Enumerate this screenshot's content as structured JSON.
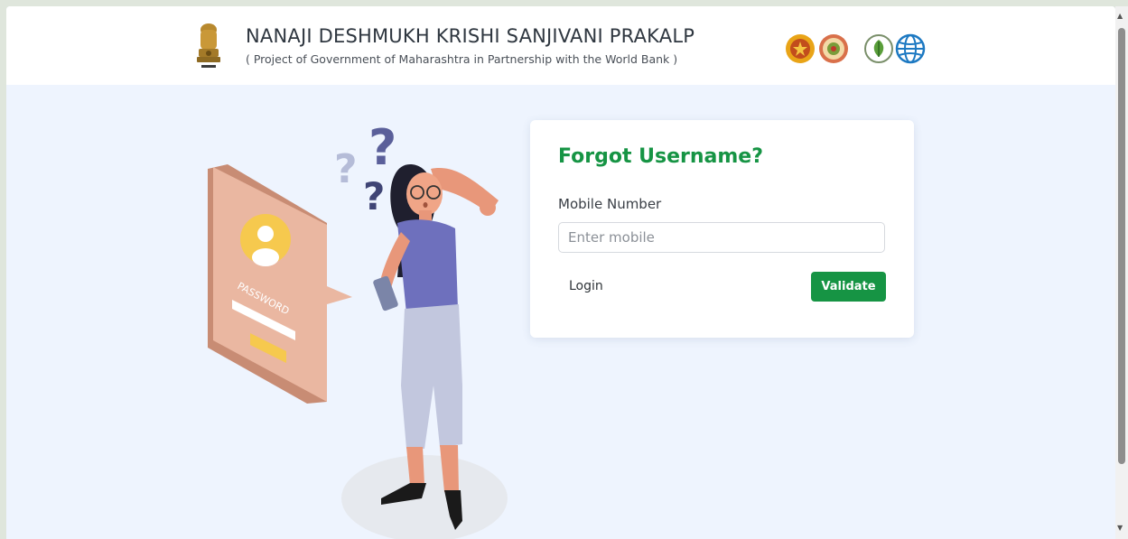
{
  "header": {
    "title": "NANAJI DESHMUKH KRISHI SANJIVANI PRAKALP",
    "subtitle": "( Project of Government of Maharashtra in Partnership with the World Bank )",
    "logos": [
      "national-emblem",
      "maharashtra-govt-seal",
      "agriculture-dept-seal",
      "pocra-leaf-logo",
      "world-bank-globe"
    ]
  },
  "illustration": {
    "badge_text": "PASSWORD"
  },
  "form": {
    "title": "Forgot Username?",
    "mobile_label": "Mobile Number",
    "mobile_placeholder": "Enter mobile",
    "mobile_value": "",
    "login_label": "Login",
    "validate_label": "Validate"
  },
  "colors": {
    "accent": "#169444",
    "background": "#eef4fe",
    "header_bg": "#ffffff"
  }
}
